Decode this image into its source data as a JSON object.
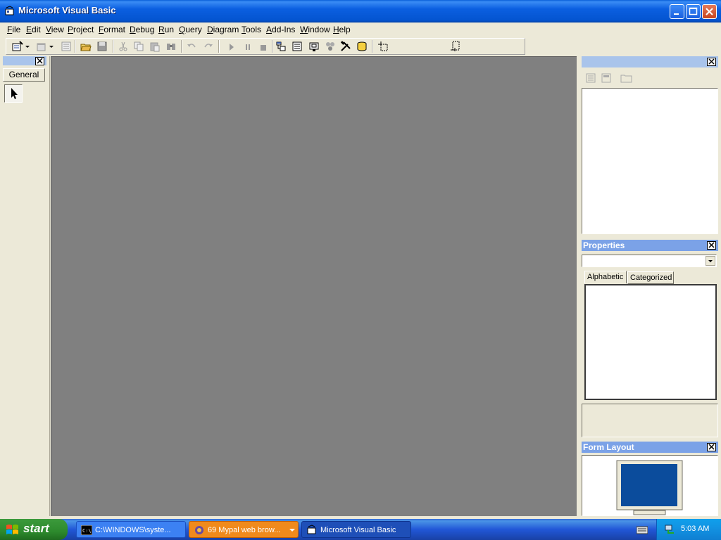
{
  "window": {
    "title": "Microsoft Visual Basic"
  },
  "menu": [
    "File",
    "Edit",
    "View",
    "Project",
    "Format",
    "Debug",
    "Run",
    "Query",
    "Diagram",
    "Tools",
    "Add-Ins",
    "Window",
    "Help"
  ],
  "toolbox": {
    "tab_label": "General"
  },
  "properties": {
    "title": "Properties",
    "tab_alphabetic": "Alphabetic",
    "tab_categorized": "Categorized"
  },
  "form_layout": {
    "title": "Form Layout"
  },
  "taskbar": {
    "start_label": "start",
    "tasks": [
      {
        "label": "C:\\WINDOWS\\syste..."
      },
      {
        "label": "69 Mypal web brow..."
      },
      {
        "label": "Microsoft Visual Basic"
      }
    ],
    "clock": "5:03 AM"
  },
  "colors": {
    "titlebar": "#0454d0",
    "workspace": "#808080",
    "panel_header": "#7ba2e7",
    "monitor_screen": "#0b4c9c"
  }
}
